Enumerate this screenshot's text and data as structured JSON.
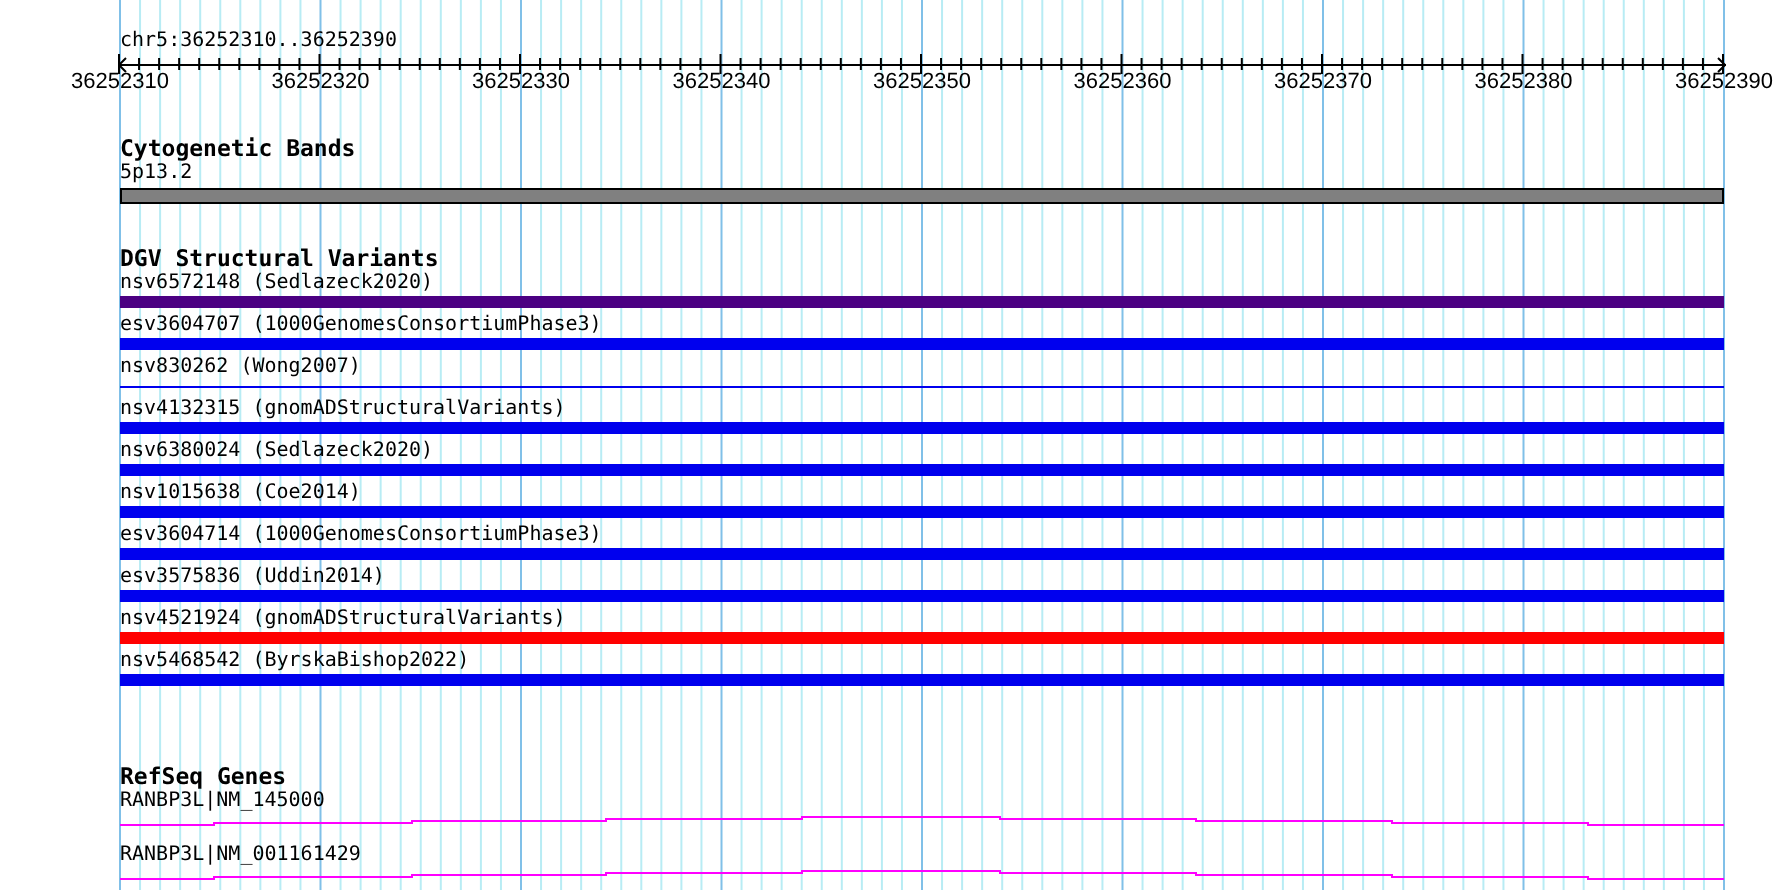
{
  "location": "chr5:36252310..36252390",
  "ruler": {
    "labels": [
      "36252310",
      "36252320",
      "36252330",
      "36252340",
      "36252350",
      "36252360",
      "36252370",
      "36252380",
      "36252390"
    ]
  },
  "tracks": [
    {
      "title": "Cytogenetic Bands",
      "kind": "bands",
      "features": [
        {
          "label": "5p13.2"
        }
      ]
    },
    {
      "title": "DGV Structural Variants",
      "kind": "variants",
      "features": [
        {
          "label": "nsv6572148 (Sedlazeck2020)",
          "kind": "bar",
          "color": "#4b0082"
        },
        {
          "label": "esv3604707 (1000GenomesConsortiumPhase3)",
          "kind": "bar",
          "color": "#0000ee"
        },
        {
          "label": "nsv830262 (Wong2007)",
          "kind": "line",
          "color": "#0000ee"
        },
        {
          "label": "nsv4132315 (gnomADStructuralVariants)",
          "kind": "bar",
          "color": "#0000ee"
        },
        {
          "label": "nsv6380024 (Sedlazeck2020)",
          "kind": "bar",
          "color": "#0000ee"
        },
        {
          "label": "nsv1015638 (Coe2014)",
          "kind": "bar",
          "color": "#0000ee"
        },
        {
          "label": "esv3604714 (1000GenomesConsortiumPhase3)",
          "kind": "bar",
          "color": "#0000ee"
        },
        {
          "label": "esv3575836 (Uddin2014)",
          "kind": "bar",
          "color": "#0000ee"
        },
        {
          "label": "nsv4521924 (gnomADStructuralVariants)",
          "kind": "bar",
          "color": "#ff0000"
        },
        {
          "label": "nsv5468542 (ByrskaBishop2022)",
          "kind": "bar",
          "color": "#0000ee"
        }
      ]
    },
    {
      "title": "RefSeq Genes",
      "kind": "genes",
      "features": [
        {
          "label": "RANBP3L|NM_145000"
        },
        {
          "label": "RANBP3L|NM_001161429"
        }
      ]
    }
  ]
}
